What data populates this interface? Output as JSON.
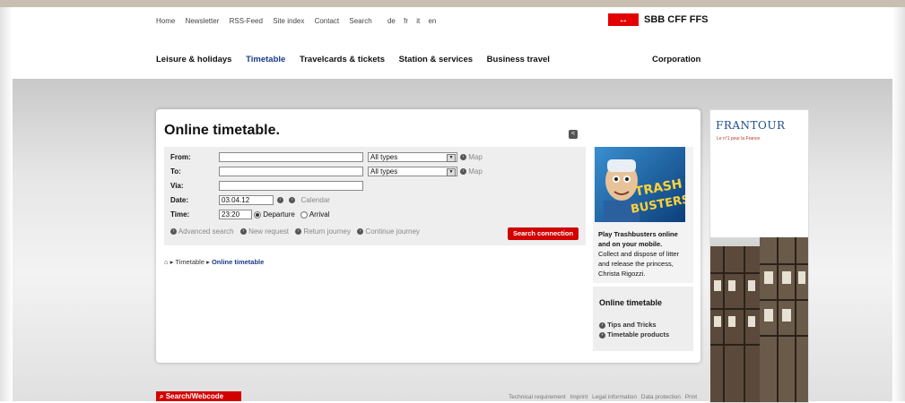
{
  "topnav": {
    "home": "Home",
    "newsletter": "Newsletter",
    "rss": "RSS-Feed",
    "siteindex": "Site index",
    "contact": "Contact",
    "search": "Search",
    "lang_de": "de",
    "lang_fr": "fr",
    "lang_it": "it",
    "lang_en": "en"
  },
  "brand": {
    "mark": "↔",
    "name": "SBB CFF FFS"
  },
  "mainnav": {
    "leisure": "Leisure & holidays",
    "timetable": "Timetable",
    "travelcards": "Travelcards & tickets",
    "station": "Station & services",
    "business": "Business travel",
    "corporation": "Corporation"
  },
  "panel": {
    "title": "Online timetable."
  },
  "form": {
    "from_label": "From:",
    "to_label": "To:",
    "via_label": "Via:",
    "date_label": "Date:",
    "time_label": "Time:",
    "from_value": "",
    "to_value": "",
    "via_value": "",
    "type_from": "All types",
    "type_to": "All types",
    "map": "Map",
    "date_value": "03.04.12",
    "calendar": "Calendar",
    "time_value": "23:20",
    "departure": "Departure",
    "arrival": "Arrival",
    "advanced": "Advanced search",
    "newreq": "New request",
    "return": "Return journey",
    "continue": "Continue journey",
    "search_btn": "Search connection"
  },
  "breadcrumb": {
    "timetable": "Timetable",
    "current": "Online timetable"
  },
  "promo": {
    "line1": "Play Trashbusters online",
    "line2": "and on your mobile.",
    "line3": "Collect and dispose of litter",
    "line4": "and release the princess,",
    "line5": "Christa Rigozzi.",
    "game_title1": "TRASH",
    "game_title2": "BUSTERS"
  },
  "sidebox": {
    "title": "Online timetable",
    "tips": "Tips and Tricks",
    "products": "Timetable products"
  },
  "ad": {
    "title": "FRANTOUR",
    "subtitle": "Le n°1 pour la France"
  },
  "search_webcode": "Search/Webcode",
  "footer": {
    "tech": "Technical requirement",
    "imprint": "Imprint",
    "legal": "Legal information",
    "privacy": "Data protection",
    "print": "Print"
  }
}
